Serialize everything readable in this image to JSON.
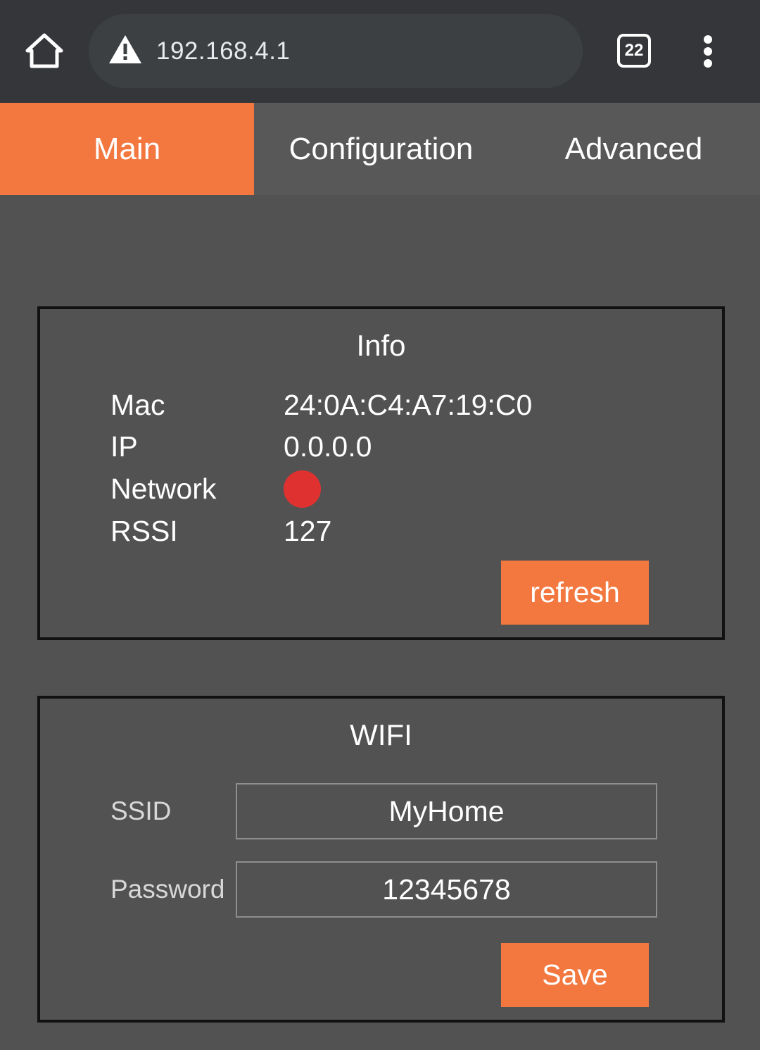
{
  "browser": {
    "url": "192.168.4.1",
    "tab_count": "22",
    "icons": [
      "home-icon",
      "warning-icon",
      "tabs-icon",
      "more-vert-icon"
    ]
  },
  "nav": {
    "tabs": [
      {
        "label": "Main",
        "active": true
      },
      {
        "label": "Configuration",
        "active": false
      },
      {
        "label": "Advanced",
        "active": false
      }
    ]
  },
  "info": {
    "title": "Info",
    "rows": [
      {
        "label": "Mac",
        "value": "24:0A:C4:A7:19:C0"
      },
      {
        "label": "IP",
        "value": "0.0.0.0"
      },
      {
        "label": "Network",
        "status_color": "#e03131"
      },
      {
        "label": "RSSI",
        "value": "127"
      }
    ],
    "refresh_label": "refresh"
  },
  "wifi": {
    "title": "WIFI",
    "ssid_label": "SSID",
    "ssid_value": "MyHome",
    "password_label": "Password",
    "password_value": "12345678",
    "save_label": "Save"
  },
  "colors": {
    "accent": "#f37840",
    "background": "#525252",
    "status_offline": "#e03131"
  }
}
